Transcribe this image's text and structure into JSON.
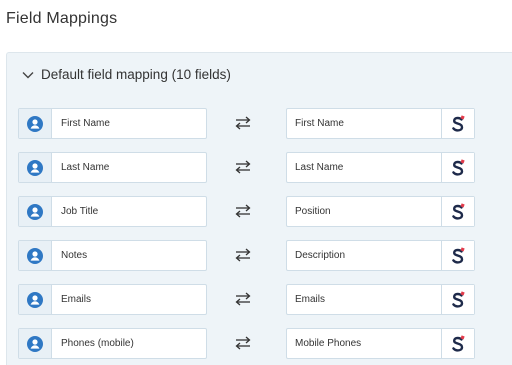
{
  "page": {
    "title": "Field Mappings"
  },
  "section": {
    "title": "Default field mapping (10 fields)",
    "expanded": true
  },
  "colors": {
    "accent": "#2f78c4",
    "brand_dark": "#1e2a4a",
    "brand_red": "#e23a4a",
    "panel_bg": "#eef4f8"
  },
  "icons": {
    "left": "person-circle-icon",
    "swap": "swap-arrows-icon",
    "right": "brand-s-logo-icon",
    "collapse": "chevron-down-icon"
  },
  "mappings": [
    {
      "source": "First Name",
      "target": "First Name"
    },
    {
      "source": "Last Name",
      "target": "Last Name"
    },
    {
      "source": "Job Title",
      "target": "Position"
    },
    {
      "source": "Notes",
      "target": "Description"
    },
    {
      "source": "Emails",
      "target": "Emails"
    },
    {
      "source": "Phones (mobile)",
      "target": "Mobile Phones"
    }
  ]
}
